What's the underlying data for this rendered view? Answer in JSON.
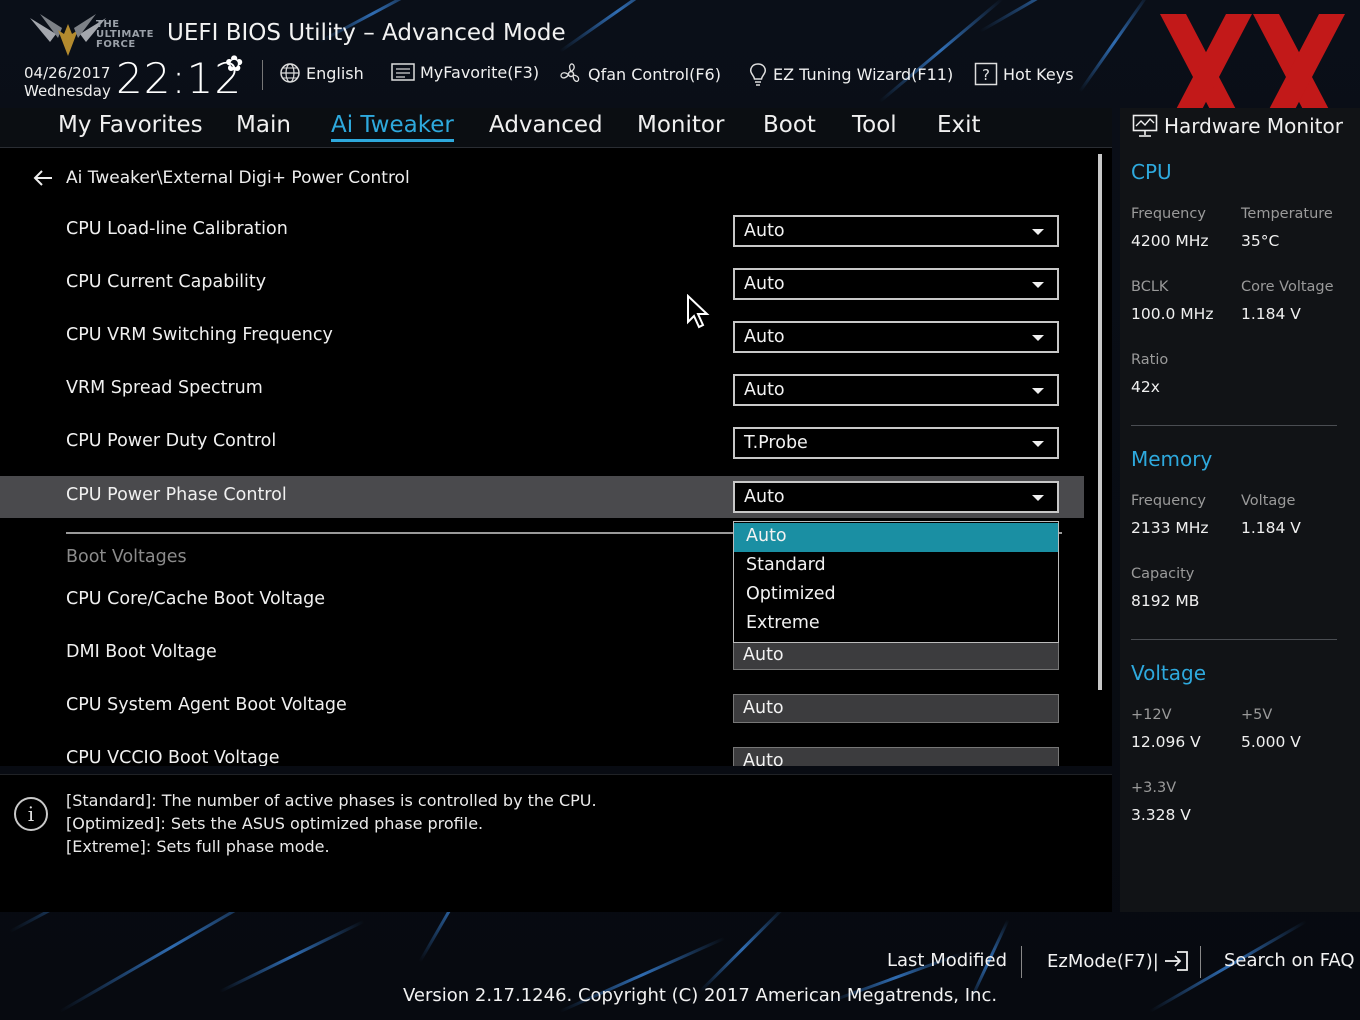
{
  "header": {
    "title": "UEFI BIOS Utility – Advanced Mode",
    "logo_text": "THE ULTIMATE FORCE",
    "date": "04/26/2017",
    "weekday": "Wednesday",
    "time": "22:12",
    "tools": [
      {
        "label": "English",
        "icon": "globe-icon"
      },
      {
        "label": "MyFavorite(F3)",
        "icon": "favorite-list-icon"
      },
      {
        "label": "Qfan Control(F6)",
        "icon": "fan-icon"
      },
      {
        "label": "EZ Tuning Wizard(F11)",
        "icon": "lightbulb-icon"
      },
      {
        "label": "Hot Keys",
        "icon": "question-box-icon"
      }
    ]
  },
  "nav": {
    "tabs": [
      "My Favorites",
      "Main",
      "Ai Tweaker",
      "Advanced",
      "Monitor",
      "Boot",
      "Tool",
      "Exit"
    ],
    "active": "Ai Tweaker"
  },
  "main": {
    "breadcrumb": "Ai Tweaker\\External Digi+ Power Control",
    "settings": [
      {
        "label": "CPU Load-line Calibration",
        "value": "Auto"
      },
      {
        "label": "CPU Current Capability",
        "value": "Auto"
      },
      {
        "label": "CPU VRM Switching Frequency",
        "value": "Auto"
      },
      {
        "label": "VRM Spread Spectrum",
        "value": "Auto"
      },
      {
        "label": "CPU Power Duty Control",
        "value": "T.Probe"
      },
      {
        "label": "CPU Power Phase Control",
        "value": "Auto"
      }
    ],
    "section_title": "Boot Voltages",
    "boot_voltages": [
      {
        "label": "CPU Core/Cache Boot Voltage",
        "value": ""
      },
      {
        "label": "DMI Boot Voltage",
        "value": "Auto"
      },
      {
        "label": "CPU System Agent Boot Voltage",
        "value": "Auto"
      },
      {
        "label": "CPU VCCIO Boot Voltage",
        "value": "Auto"
      }
    ],
    "dropdown": {
      "options": [
        "Auto",
        "Standard",
        "Optimized",
        "Extreme"
      ],
      "selected": "Auto"
    }
  },
  "info": {
    "lines": [
      "[Standard]: The number of active phases is controlled by the CPU.",
      "[Optimized]: Sets the ASUS optimized phase profile.",
      "[Extreme]: Sets full phase mode."
    ]
  },
  "hw_monitor": {
    "title": "Hardware Monitor",
    "cpu": {
      "heading": "CPU",
      "frequency_label": "Frequency",
      "frequency": "4200 MHz",
      "temperature_label": "Temperature",
      "temperature": "35°C",
      "bclk_label": "BCLK",
      "bclk": "100.0 MHz",
      "core_voltage_label": "Core Voltage",
      "core_voltage": "1.184 V",
      "ratio_label": "Ratio",
      "ratio": "42x"
    },
    "memory": {
      "heading": "Memory",
      "frequency_label": "Frequency",
      "frequency": "2133 MHz",
      "voltage_label": "Voltage",
      "voltage": "1.184 V",
      "capacity_label": "Capacity",
      "capacity": "8192 MB"
    },
    "voltage": {
      "heading": "Voltage",
      "v12_label": "+12V",
      "v12": "12.096 V",
      "v5_label": "+5V",
      "v5": "5.000 V",
      "v33_label": "+3.3V",
      "v33": "3.328 V"
    }
  },
  "footer": {
    "last_modified": "Last Modified",
    "ezmode": "EzMode(F7)|",
    "search_faq": "Search on FAQ",
    "version": "Version 2.17.1246. Copyright (C) 2017 American Megatrends, Inc."
  },
  "colors": {
    "accent": "#2ea9dd",
    "dropdown_selected": "#1a8fa3",
    "highlight_row": "#4a4a4d",
    "watermark": "#d21a1a"
  }
}
